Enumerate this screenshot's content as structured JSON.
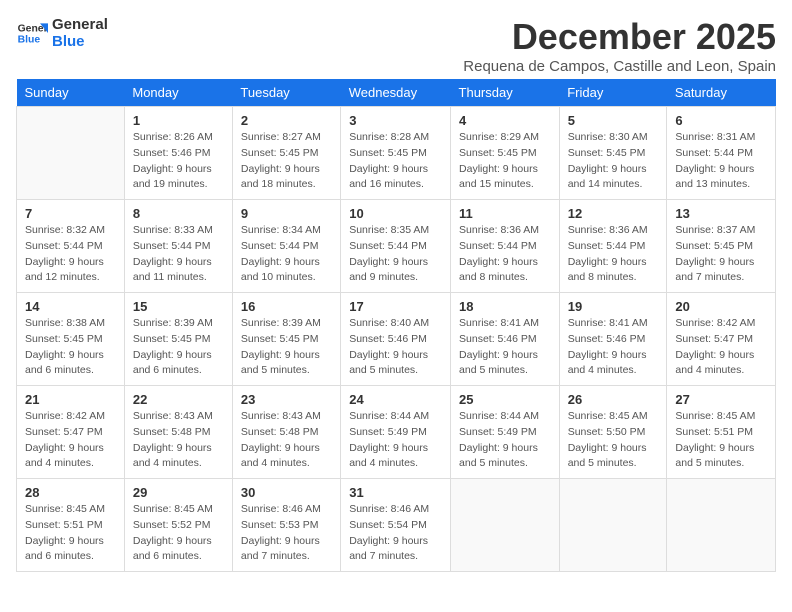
{
  "logo": {
    "line1": "General",
    "line2": "Blue"
  },
  "title": "December 2025",
  "subtitle": "Requena de Campos, Castille and Leon, Spain",
  "days_of_week": [
    "Sunday",
    "Monday",
    "Tuesday",
    "Wednesday",
    "Thursday",
    "Friday",
    "Saturday"
  ],
  "weeks": [
    [
      {
        "day": "",
        "info": ""
      },
      {
        "day": "1",
        "info": "Sunrise: 8:26 AM\nSunset: 5:46 PM\nDaylight: 9 hours\nand 19 minutes."
      },
      {
        "day": "2",
        "info": "Sunrise: 8:27 AM\nSunset: 5:45 PM\nDaylight: 9 hours\nand 18 minutes."
      },
      {
        "day": "3",
        "info": "Sunrise: 8:28 AM\nSunset: 5:45 PM\nDaylight: 9 hours\nand 16 minutes."
      },
      {
        "day": "4",
        "info": "Sunrise: 8:29 AM\nSunset: 5:45 PM\nDaylight: 9 hours\nand 15 minutes."
      },
      {
        "day": "5",
        "info": "Sunrise: 8:30 AM\nSunset: 5:45 PM\nDaylight: 9 hours\nand 14 minutes."
      },
      {
        "day": "6",
        "info": "Sunrise: 8:31 AM\nSunset: 5:44 PM\nDaylight: 9 hours\nand 13 minutes."
      }
    ],
    [
      {
        "day": "7",
        "info": "Sunrise: 8:32 AM\nSunset: 5:44 PM\nDaylight: 9 hours\nand 12 minutes."
      },
      {
        "day": "8",
        "info": "Sunrise: 8:33 AM\nSunset: 5:44 PM\nDaylight: 9 hours\nand 11 minutes."
      },
      {
        "day": "9",
        "info": "Sunrise: 8:34 AM\nSunset: 5:44 PM\nDaylight: 9 hours\nand 10 minutes."
      },
      {
        "day": "10",
        "info": "Sunrise: 8:35 AM\nSunset: 5:44 PM\nDaylight: 9 hours\nand 9 minutes."
      },
      {
        "day": "11",
        "info": "Sunrise: 8:36 AM\nSunset: 5:44 PM\nDaylight: 9 hours\nand 8 minutes."
      },
      {
        "day": "12",
        "info": "Sunrise: 8:36 AM\nSunset: 5:44 PM\nDaylight: 9 hours\nand 8 minutes."
      },
      {
        "day": "13",
        "info": "Sunrise: 8:37 AM\nSunset: 5:45 PM\nDaylight: 9 hours\nand 7 minutes."
      }
    ],
    [
      {
        "day": "14",
        "info": "Sunrise: 8:38 AM\nSunset: 5:45 PM\nDaylight: 9 hours\nand 6 minutes."
      },
      {
        "day": "15",
        "info": "Sunrise: 8:39 AM\nSunset: 5:45 PM\nDaylight: 9 hours\nand 6 minutes."
      },
      {
        "day": "16",
        "info": "Sunrise: 8:39 AM\nSunset: 5:45 PM\nDaylight: 9 hours\nand 5 minutes."
      },
      {
        "day": "17",
        "info": "Sunrise: 8:40 AM\nSunset: 5:46 PM\nDaylight: 9 hours\nand 5 minutes."
      },
      {
        "day": "18",
        "info": "Sunrise: 8:41 AM\nSunset: 5:46 PM\nDaylight: 9 hours\nand 5 minutes."
      },
      {
        "day": "19",
        "info": "Sunrise: 8:41 AM\nSunset: 5:46 PM\nDaylight: 9 hours\nand 4 minutes."
      },
      {
        "day": "20",
        "info": "Sunrise: 8:42 AM\nSunset: 5:47 PM\nDaylight: 9 hours\nand 4 minutes."
      }
    ],
    [
      {
        "day": "21",
        "info": "Sunrise: 8:42 AM\nSunset: 5:47 PM\nDaylight: 9 hours\nand 4 minutes."
      },
      {
        "day": "22",
        "info": "Sunrise: 8:43 AM\nSunset: 5:48 PM\nDaylight: 9 hours\nand 4 minutes."
      },
      {
        "day": "23",
        "info": "Sunrise: 8:43 AM\nSunset: 5:48 PM\nDaylight: 9 hours\nand 4 minutes."
      },
      {
        "day": "24",
        "info": "Sunrise: 8:44 AM\nSunset: 5:49 PM\nDaylight: 9 hours\nand 4 minutes."
      },
      {
        "day": "25",
        "info": "Sunrise: 8:44 AM\nSunset: 5:49 PM\nDaylight: 9 hours\nand 5 minutes."
      },
      {
        "day": "26",
        "info": "Sunrise: 8:45 AM\nSunset: 5:50 PM\nDaylight: 9 hours\nand 5 minutes."
      },
      {
        "day": "27",
        "info": "Sunrise: 8:45 AM\nSunset: 5:51 PM\nDaylight: 9 hours\nand 5 minutes."
      }
    ],
    [
      {
        "day": "28",
        "info": "Sunrise: 8:45 AM\nSunset: 5:51 PM\nDaylight: 9 hours\nand 6 minutes."
      },
      {
        "day": "29",
        "info": "Sunrise: 8:45 AM\nSunset: 5:52 PM\nDaylight: 9 hours\nand 6 minutes."
      },
      {
        "day": "30",
        "info": "Sunrise: 8:46 AM\nSunset: 5:53 PM\nDaylight: 9 hours\nand 7 minutes."
      },
      {
        "day": "31",
        "info": "Sunrise: 8:46 AM\nSunset: 5:54 PM\nDaylight: 9 hours\nand 7 minutes."
      },
      {
        "day": "",
        "info": ""
      },
      {
        "day": "",
        "info": ""
      },
      {
        "day": "",
        "info": ""
      }
    ]
  ]
}
